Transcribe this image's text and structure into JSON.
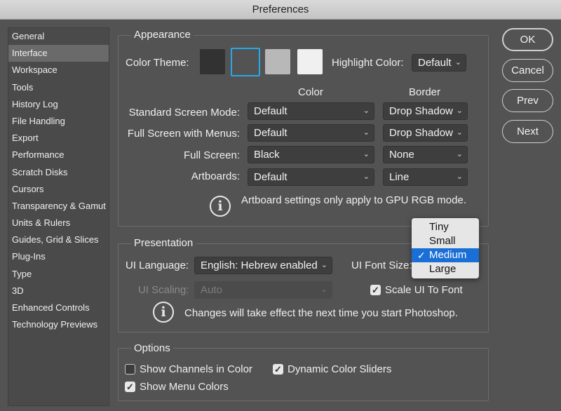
{
  "window": {
    "title": "Preferences"
  },
  "sidebar": {
    "items": [
      {
        "label": "General"
      },
      {
        "label": "Interface"
      },
      {
        "label": "Workspace"
      },
      {
        "label": "Tools"
      },
      {
        "label": "History Log"
      },
      {
        "label": "File Handling"
      },
      {
        "label": "Export"
      },
      {
        "label": "Performance"
      },
      {
        "label": "Scratch Disks"
      },
      {
        "label": "Cursors"
      },
      {
        "label": "Transparency & Gamut"
      },
      {
        "label": "Units & Rulers"
      },
      {
        "label": "Guides, Grid & Slices"
      },
      {
        "label": "Plug-Ins"
      },
      {
        "label": "Type"
      },
      {
        "label": "3D"
      },
      {
        "label": "Enhanced Controls"
      },
      {
        "label": "Technology Previews"
      }
    ],
    "selected": "Interface"
  },
  "appearance": {
    "title": "Appearance",
    "color_theme_label": "Color Theme:",
    "themes": [
      {
        "name": "darkest",
        "color": "#323232"
      },
      {
        "name": "dark",
        "color": "#535353",
        "selected": true
      },
      {
        "name": "medium",
        "color": "#b8b8b8"
      },
      {
        "name": "light",
        "color": "#f0f0f0"
      }
    ],
    "highlight_label": "Highlight Color:",
    "highlight_value": "Default",
    "col_color": "Color",
    "col_border": "Border",
    "rows": [
      {
        "label": "Standard Screen Mode:",
        "color": "Default",
        "border": "Drop Shadow"
      },
      {
        "label": "Full Screen with Menus:",
        "color": "Default",
        "border": "Drop Shadow"
      },
      {
        "label": "Full Screen:",
        "color": "Black",
        "border": "None"
      },
      {
        "label": "Artboards:",
        "color": "Default",
        "border": "Line"
      }
    ],
    "note": "Artboard settings only apply to GPU RGB mode."
  },
  "presentation": {
    "title": "Presentation",
    "language_label": "UI Language:",
    "language_value": "English: Hebrew enabled",
    "font_size_label": "UI Font Size:",
    "font_size_options": [
      "Tiny",
      "Small",
      "Medium",
      "Large"
    ],
    "font_size_selected": "Medium",
    "scaling_label": "UI Scaling:",
    "scaling_value": "Auto",
    "scale_to_font_label": "Scale UI To Font",
    "scale_to_font_checked": true,
    "note": "Changes will take effect the next time you start Photoshop."
  },
  "options": {
    "title": "Options",
    "show_channels_label": "Show Channels in Color",
    "show_channels_checked": false,
    "dynamic_sliders_label": "Dynamic Color Sliders",
    "dynamic_sliders_checked": true,
    "show_menu_colors_label": "Show Menu Colors",
    "show_menu_colors_checked": true
  },
  "buttons": {
    "ok": "OK",
    "cancel": "Cancel",
    "prev": "Prev",
    "next": "Next"
  },
  "colors": {
    "accent": "#2aa7e6",
    "highlight": "#1a6fd6",
    "background": "#535353"
  }
}
